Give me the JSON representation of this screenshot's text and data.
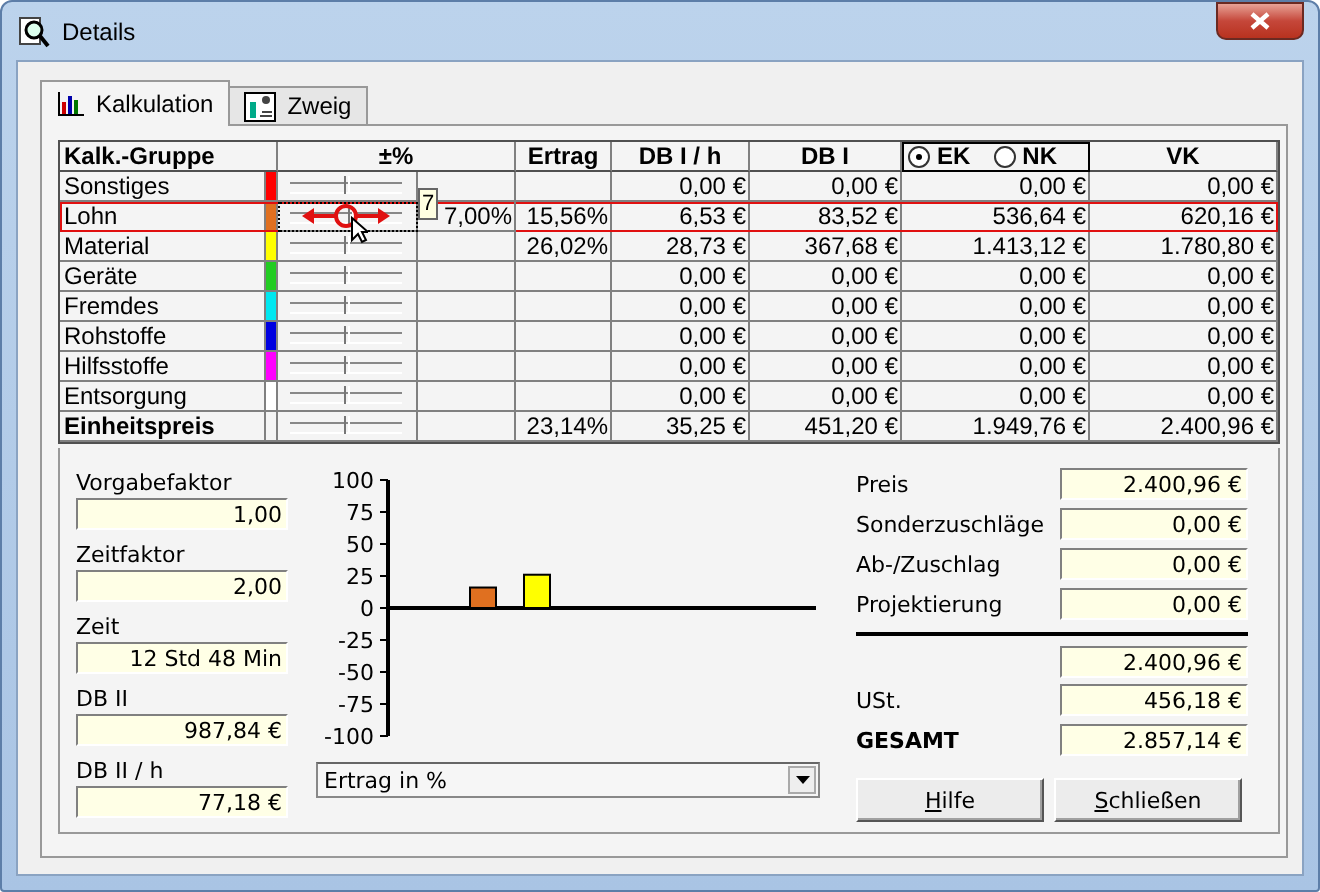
{
  "window": {
    "title": "Details"
  },
  "tabs": [
    {
      "label": "Kalkulation",
      "selected": true
    },
    {
      "label": "Zweig",
      "selected": false
    }
  ],
  "table": {
    "columns": [
      "Kalk.-Gruppe",
      "±%",
      "Ertrag",
      "DB I / h",
      "DB I",
      "VK"
    ],
    "basis": [
      {
        "label": "EK",
        "selected": true
      },
      {
        "label": "NK",
        "selected": false
      }
    ],
    "rows": [
      {
        "kind": "group",
        "name": "Sonstiges",
        "color": "#ff0000",
        "level": 0.5,
        "selected": false,
        "db_h": "0,00 €",
        "db": "0,00 €",
        "ek": "0,00 €",
        "vk": "0,00 €"
      },
      {
        "kind": "group",
        "name": "Lohn",
        "color": "#e07020",
        "level": 0.53,
        "selected": true,
        "tooltip": "7",
        "percent": "7,00%",
        "ertrag": "15,56%",
        "db_h": "6,53 €",
        "db": "83,52 €",
        "ek": "536,64 €",
        "vk": "620,16 €"
      },
      {
        "kind": "group",
        "name": "Material",
        "color": "#ffff00",
        "level": 0.5,
        "selected": false,
        "ertrag": "26,02%",
        "db_h": "28,73 €",
        "db": "367,68 €",
        "ek": "1.413,12 €",
        "vk": "1.780,80 €"
      },
      {
        "kind": "group",
        "name": "Geräte",
        "color": "#22cc22",
        "level": 0.5,
        "selected": false,
        "db_h": "0,00 €",
        "db": "0,00 €",
        "ek": "0,00 €",
        "vk": "0,00 €"
      },
      {
        "kind": "group",
        "name": "Fremdes",
        "color": "#00e8f0",
        "level": 0.5,
        "selected": false,
        "db_h": "0,00 €",
        "db": "0,00 €",
        "ek": "0,00 €",
        "vk": "0,00 €"
      },
      {
        "kind": "group",
        "name": "Rohstoffe",
        "color": "#0000e0",
        "level": 0.5,
        "selected": false,
        "db_h": "0,00 €",
        "db": "0,00 €",
        "ek": "0,00 €",
        "vk": "0,00 €"
      },
      {
        "kind": "group",
        "name": "Hilfsstoffe",
        "color": "#ff00ff",
        "level": 0.5,
        "selected": false,
        "db_h": "0,00 €",
        "db": "0,00 €",
        "ek": "0,00 €",
        "vk": "0,00 €"
      },
      {
        "kind": "group",
        "name": "Entsorgung",
        "color": "#ffffff",
        "level": 0.5,
        "selected": false,
        "db_h": "0,00 €",
        "db": "0,00 €",
        "ek": "0,00 €",
        "vk": "0,00 €"
      },
      {
        "kind": "total",
        "name": "Einheitspreis",
        "level": 0.5,
        "selected": false,
        "ertrag": "23,14%",
        "db_h": "35,25 €",
        "db": "451,20 €",
        "ek": "1.949,76 €",
        "vk": "2.400,96 €"
      }
    ]
  },
  "factors": [
    {
      "label": "Vorgabefaktor",
      "value": "1,00"
    },
    {
      "label": "Zeitfaktor",
      "value": "2,00"
    },
    {
      "label": "Zeit",
      "value": "12 Std 48 Min"
    },
    {
      "label": "DB II",
      "value": "987,84 €"
    },
    {
      "label": "DB II / h",
      "value": "77,18 €"
    }
  ],
  "chart": {
    "chart_data": {
      "type": "bar",
      "ylim": [
        -100,
        100
      ],
      "yticks": [
        100,
        75,
        50,
        25,
        0,
        -25,
        -50,
        -75,
        -100
      ],
      "series": [
        {
          "name": "Ertrag in %",
          "values": [
            0,
            16,
            26,
            0,
            0,
            0,
            0,
            0
          ]
        }
      ]
    }
  },
  "summary": [
    {
      "kind": "line",
      "label": "Preis",
      "value": "2.400,96 €"
    },
    {
      "kind": "line",
      "label": "Sonderzuschläge",
      "value": "0,00 €"
    },
    {
      "kind": "line",
      "label": "Ab-/Zuschlag",
      "value": "0,00 €"
    },
    {
      "kind": "line",
      "label": "Projektierung",
      "value": "0,00 €"
    },
    {
      "kind": "subtotal",
      "value": "2.400,96 €"
    },
    {
      "kind": "line",
      "label": "USt.",
      "value": "456,18 €"
    },
    {
      "kind": "total",
      "label": "GESAMT",
      "value": "2.857,14 €"
    }
  ],
  "buttons": [
    "Hilfe",
    "Schließen"
  ]
}
